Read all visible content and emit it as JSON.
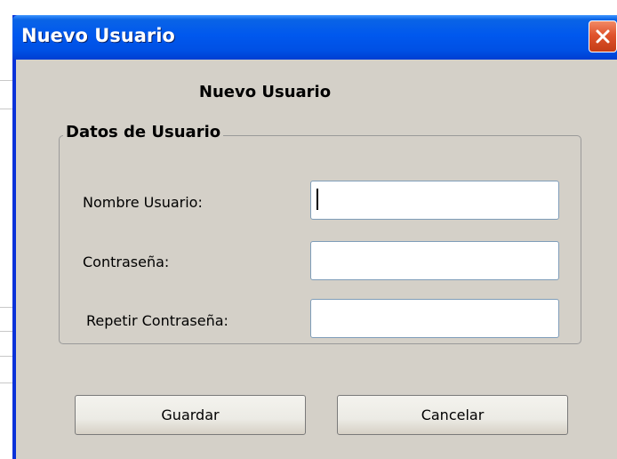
{
  "window": {
    "title": "Nuevo Usuario"
  },
  "dialog": {
    "heading": "Nuevo Usuario"
  },
  "group": {
    "legend": "Datos de Usuario"
  },
  "fields": {
    "username": {
      "label": "Nombre Usuario:",
      "value": ""
    },
    "password": {
      "label": "Contraseña:",
      "value": ""
    },
    "repeat_password": {
      "label": "Repetir Contraseña:",
      "value": ""
    }
  },
  "buttons": {
    "save": "Guardar",
    "cancel": "Cancelar"
  },
  "colors": {
    "titlebar": "#0058ee",
    "client_bg": "#d4d0c8",
    "close_button": "#e0532c"
  }
}
